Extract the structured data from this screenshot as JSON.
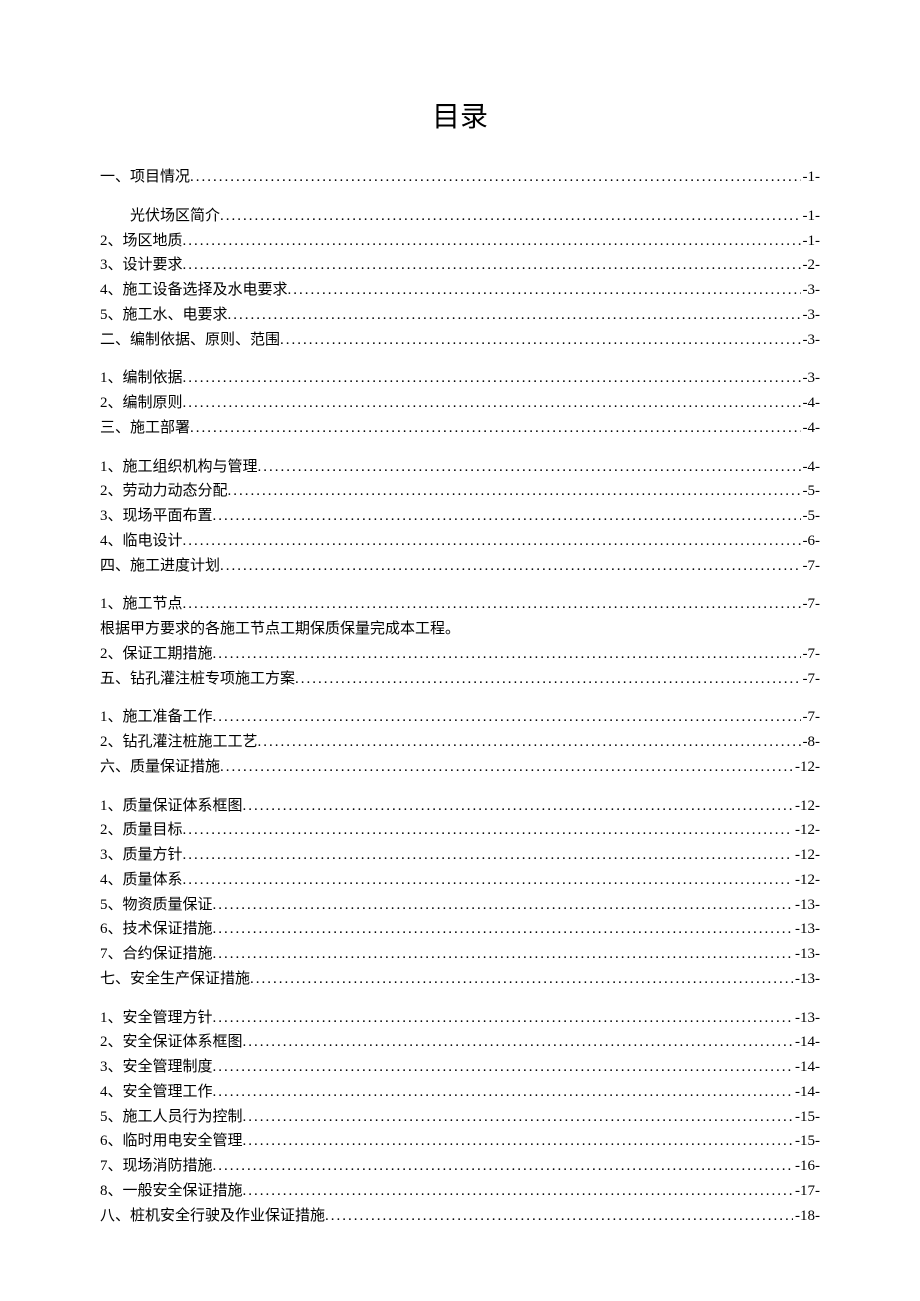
{
  "title": "目录",
  "entries": [
    {
      "label": "一、项目情况",
      "page": "-1-",
      "indent": false,
      "group_end": true
    },
    {
      "label": "光伏场区简介",
      "page": "-1-",
      "indent": true
    },
    {
      "label": "2、场区地质",
      "page": "-1-",
      "indent": false
    },
    {
      "label": "3、设计要求",
      "page": "-2-",
      "indent": false
    },
    {
      "label": "4、施工设备选择及水电要求",
      "page": "-3-",
      "indent": false
    },
    {
      "label": "5、施工水、电要求",
      "page": "-3-",
      "indent": false
    },
    {
      "label": "二、编制依据、原则、范围",
      "page": "-3-",
      "indent": false,
      "group_end": true
    },
    {
      "label": "1、编制依据",
      "page": "-3-",
      "indent": false
    },
    {
      "label": "2、编制原则",
      "page": "-4-",
      "indent": false
    },
    {
      "label": "三、施工部署",
      "page": "-4-",
      "indent": false,
      "group_end": true
    },
    {
      "label": "1、施工组织机构与管理",
      "page": "-4-",
      "indent": false
    },
    {
      "label": "2、劳动力动态分配",
      "page": "-5-",
      "indent": false
    },
    {
      "label": "3、现场平面布置",
      "page": "-5-",
      "indent": false
    },
    {
      "label": "4、临电设计",
      "page": "-6-",
      "indent": false
    },
    {
      "label": "四、施工进度计划",
      "page": "-7-",
      "indent": false,
      "group_end": true
    },
    {
      "label": "1、施工节点",
      "page": "-7-",
      "indent": false
    },
    {
      "label": "根据甲方要求的各施工节点工期保质保量完成本工程。",
      "page": "",
      "indent": false,
      "no_leader": true
    },
    {
      "label": "2、保证工期措施",
      "page": "-7-",
      "indent": false
    },
    {
      "label": "五、钻孔灌注桩专项施工方案",
      "page": "-7-",
      "indent": false,
      "group_end": true
    },
    {
      "label": "1、施工准备工作",
      "page": "-7-",
      "indent": false
    },
    {
      "label": "2、钻孔灌注桩施工工艺",
      "page": "-8-",
      "indent": false
    },
    {
      "label": "六、质量保证措施",
      "page": "-12-",
      "indent": false,
      "group_end": true
    },
    {
      "label": "1、质量保证体系框图",
      "page": "-12-",
      "indent": false
    },
    {
      "label": "2、质量目标",
      "page": "-12-",
      "indent": false
    },
    {
      "label": "3、质量方针",
      "page": "-12-",
      "indent": false
    },
    {
      "label": "4、质量体系",
      "page": "-12-",
      "indent": false
    },
    {
      "label": "5、物资质量保证",
      "page": "-13-",
      "indent": false
    },
    {
      "label": "6、技术保证措施",
      "page": "-13-",
      "indent": false
    },
    {
      "label": "7、合约保证措施",
      "page": "-13-",
      "indent": false
    },
    {
      "label": "七、安全生产保证措施",
      "page": "-13-",
      "indent": false,
      "group_end": true
    },
    {
      "label": "1、安全管理方针",
      "page": "-13-",
      "indent": false
    },
    {
      "label": "2、安全保证体系框图",
      "page": "-14-",
      "indent": false
    },
    {
      "label": "3、安全管理制度",
      "page": "-14-",
      "indent": false
    },
    {
      "label": "4、安全管理工作",
      "page": "-14-",
      "indent": false
    },
    {
      "label": "5、施工人员行为控制",
      "page": "-15-",
      "indent": false
    },
    {
      "label": "6、临时用电安全管理",
      "page": "-15-",
      "indent": false
    },
    {
      "label": "7、现场消防措施",
      "page": "-16-",
      "indent": false
    },
    {
      "label": "8、一般安全保证措施",
      "page": "-17-",
      "indent": false
    },
    {
      "label": "八、桩机安全行驶及作业保证措施",
      "page": "-18-",
      "indent": false
    }
  ]
}
